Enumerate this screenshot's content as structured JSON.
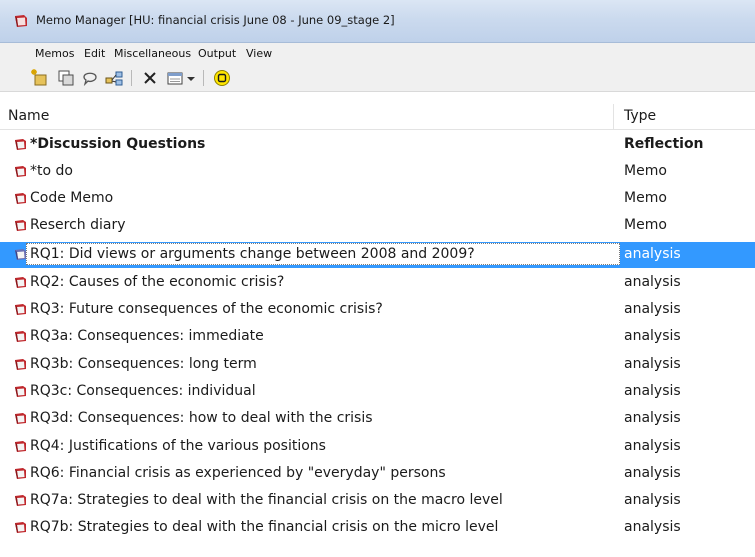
{
  "window": {
    "title": "Memo Manager [HU: financial crisis June 08 - June 09_stage 2]"
  },
  "menu": [
    {
      "label": "Memos"
    },
    {
      "label": "Edit"
    },
    {
      "label": "Miscellaneous"
    },
    {
      "label": "Output"
    },
    {
      "label": "View"
    }
  ],
  "toolbar": {
    "buttons": [
      {
        "icon": "new-memo-icon"
      },
      {
        "icon": "duplicate-icon"
      },
      {
        "icon": "comment-icon"
      },
      {
        "icon": "network-icon"
      },
      {
        "icon": "delete-icon"
      },
      {
        "icon": "view-options-icon"
      },
      {
        "icon": "dropdown-arrow-icon"
      },
      {
        "icon": "highlight-icon"
      }
    ]
  },
  "table": {
    "columns": {
      "name": "Name",
      "type": "Type"
    },
    "rows": [
      {
        "name": "*Discussion Questions",
        "type": "Reflection",
        "bold": true,
        "selected": false
      },
      {
        "name": "*to do",
        "type": "Memo",
        "bold": false,
        "selected": false
      },
      {
        "name": "Code Memo",
        "type": "Memo",
        "bold": false,
        "selected": false
      },
      {
        "name": "Reserch diary",
        "type": "Memo",
        "bold": false,
        "selected": false
      },
      {
        "name": "RQ1: Did views or arguments change between 2008 and 2009?",
        "type": "analysis",
        "bold": false,
        "selected": true
      },
      {
        "name": "RQ2: Causes of the economic crisis?",
        "type": "analysis",
        "bold": false,
        "selected": false
      },
      {
        "name": "RQ3: Future consequences of the economic crisis?",
        "type": "analysis",
        "bold": false,
        "selected": false
      },
      {
        "name": "RQ3a: Consequences: immediate",
        "type": "analysis",
        "bold": false,
        "selected": false
      },
      {
        "name": "RQ3b: Consequences: long term",
        "type": "analysis",
        "bold": false,
        "selected": false
      },
      {
        "name": "RQ3c: Consequences: individual",
        "type": "analysis",
        "bold": false,
        "selected": false
      },
      {
        "name": "RQ3d: Consequences: how to deal with the crisis",
        "type": "analysis",
        "bold": false,
        "selected": false
      },
      {
        "name": "RQ4: Justifications of the various positions",
        "type": "analysis",
        "bold": false,
        "selected": false
      },
      {
        "name": "RQ6: Financial crisis as experienced by \"everyday\" persons",
        "type": "analysis",
        "bold": false,
        "selected": false
      },
      {
        "name": "RQ7a: Strategies to deal with the financial crisis on the macro level",
        "type": "analysis",
        "bold": false,
        "selected": false
      },
      {
        "name": "RQ7b: Strategies to deal with the financial crisis on the micro level",
        "type": "analysis",
        "bold": false,
        "selected": false
      }
    ]
  }
}
